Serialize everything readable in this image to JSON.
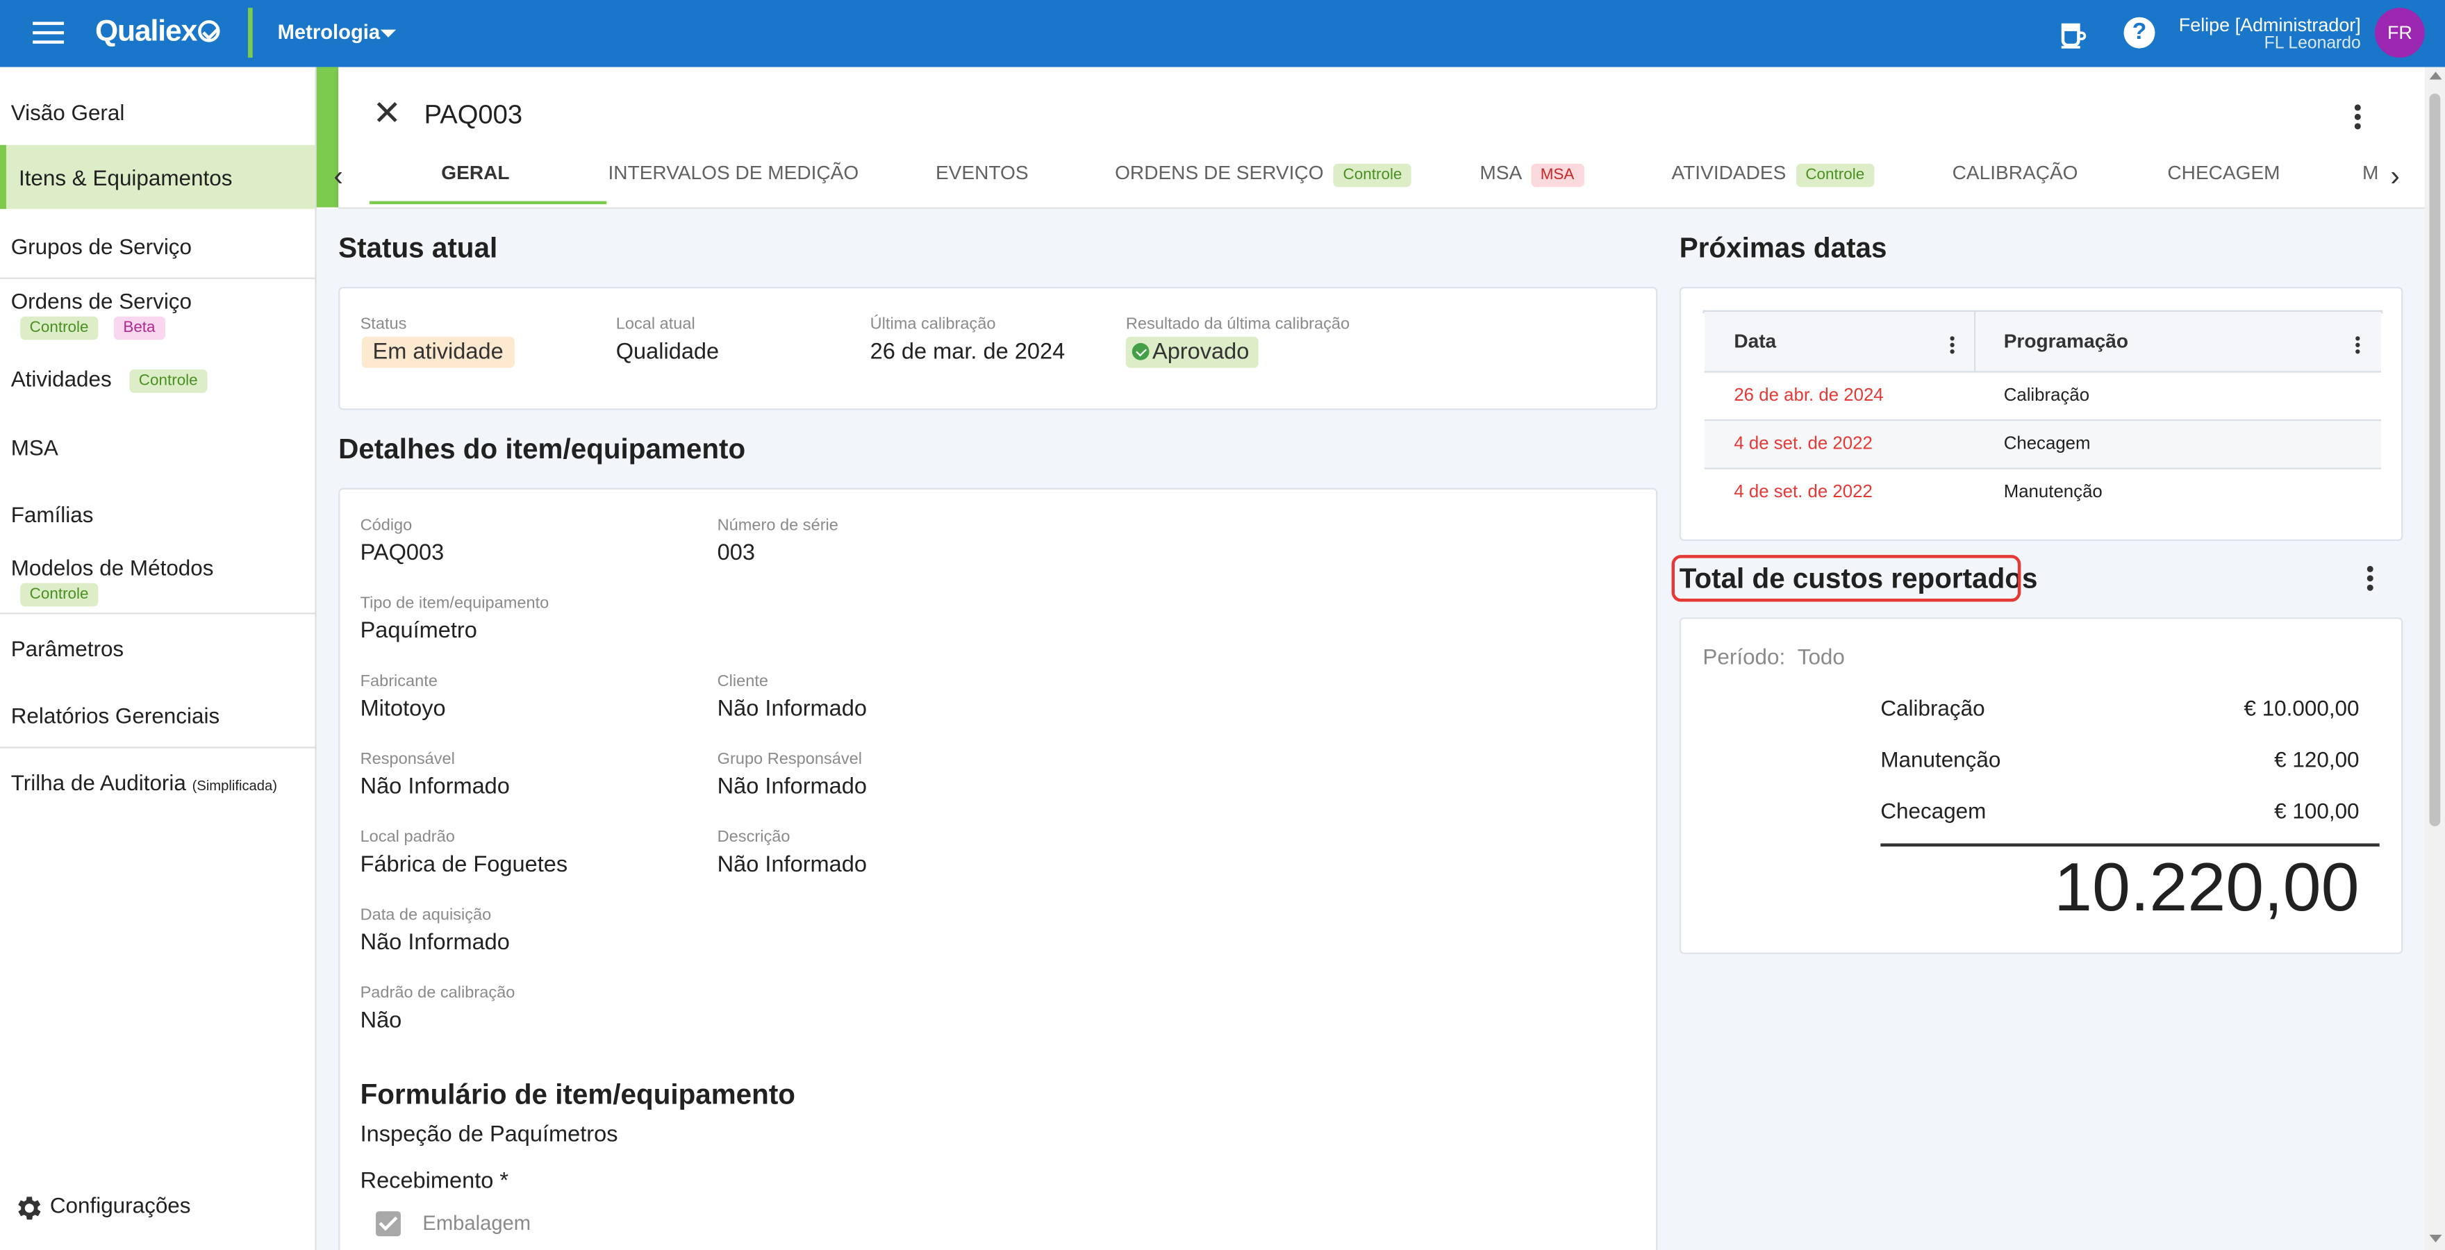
{
  "header": {
    "logo": "Qualiex",
    "module": "Metrologia",
    "user_name": "Felipe [Administrador]",
    "user_sub": "FL Leonardo",
    "avatar": "FR",
    "help": "?"
  },
  "sidebar": {
    "items": [
      {
        "label": "Visão Geral"
      },
      {
        "label": "Itens & Equipamentos"
      },
      {
        "label": "Grupos de Serviço"
      },
      {
        "label": "Ordens de Serviço",
        "chips": [
          "Controle",
          "Beta"
        ]
      },
      {
        "label": "Atividades",
        "chips": [
          "Controle"
        ]
      },
      {
        "label": "MSA"
      },
      {
        "label": "Famílias"
      },
      {
        "label": "Modelos de Métodos",
        "chips": [
          "Controle"
        ]
      },
      {
        "label": "Parâmetros"
      },
      {
        "label": "Relatórios Gerenciais"
      },
      {
        "label": "Trilha de Auditoria",
        "suffix": "(Simplificada)"
      }
    ],
    "settings": "Configurações"
  },
  "detail": {
    "code": "PAQ003",
    "tabs": [
      {
        "label": "GERAL"
      },
      {
        "label": "INTERVALOS DE MEDIÇÃO"
      },
      {
        "label": "EVENTOS"
      },
      {
        "label": "ORDENS DE SERVIÇO",
        "chip": "Controle"
      },
      {
        "label": "MSA",
        "chip": "MSA"
      },
      {
        "label": "ATIVIDADES",
        "chip": "Controle"
      },
      {
        "label": "CALIBRAÇÃO"
      },
      {
        "label": "CHECAGEM"
      },
      {
        "label": "M"
      }
    ]
  },
  "status": {
    "title": "Status atual",
    "fields": [
      {
        "label": "Status",
        "value": "Em atividade"
      },
      {
        "label": "Local atual",
        "value": "Qualidade"
      },
      {
        "label": "Última calibração",
        "value": "26 de mar. de 2024"
      },
      {
        "label": "Resultado da última calibração",
        "value": "Aprovado"
      }
    ]
  },
  "details": {
    "title": "Detalhes do item/equipamento",
    "fields": [
      {
        "label": "Código",
        "value": "PAQ003"
      },
      {
        "label": "Número de série",
        "value": "003"
      },
      {
        "label": "Tipo de item/equipamento",
        "value": "Paquímetro"
      },
      {
        "label": "Fabricante",
        "value": "Mitotoyo"
      },
      {
        "label": "Cliente",
        "value": "Não Informado"
      },
      {
        "label": "Responsável",
        "value": "Não Informado"
      },
      {
        "label": "Grupo Responsável",
        "value": "Não Informado"
      },
      {
        "label": "Local padrão",
        "value": "Fábrica de Foguetes"
      },
      {
        "label": "Descrição",
        "value": "Não Informado"
      },
      {
        "label": "Data de aquisição",
        "value": "Não Informado"
      },
      {
        "label": "Padrão de calibração",
        "value": "Não"
      }
    ],
    "form_title": "Formulário de item/equipamento",
    "form_name": "Inspeção de Paquímetros",
    "form_section": "Recebimento *",
    "form_item": "Embalagem"
  },
  "next_dates": {
    "title": "Próximas datas",
    "columns": [
      "Data",
      "Programação"
    ],
    "rows": [
      [
        "26 de abr. de 2024",
        "Calibração"
      ],
      [
        "4 de set. de 2022",
        "Checagem"
      ],
      [
        "4 de set. de 2022",
        "Manutenção"
      ]
    ],
    "date_color": "#e53935"
  },
  "costs": {
    "title": "Total de custos reportados",
    "period_label": "Período:",
    "period_value": "Todo",
    "items": [
      {
        "label": "Calibração",
        "value": "€ 10.000,00"
      },
      {
        "label": "Manutenção",
        "value": "€ 120,00"
      },
      {
        "label": "Checagem",
        "value": "€ 100,00"
      }
    ],
    "total": "10.220,00"
  },
  "colors": {
    "topbar": "#1976c9",
    "accent_green": "#7ccb4e",
    "highlight_red": "#e53935",
    "avatar": "#9c27b0"
  }
}
